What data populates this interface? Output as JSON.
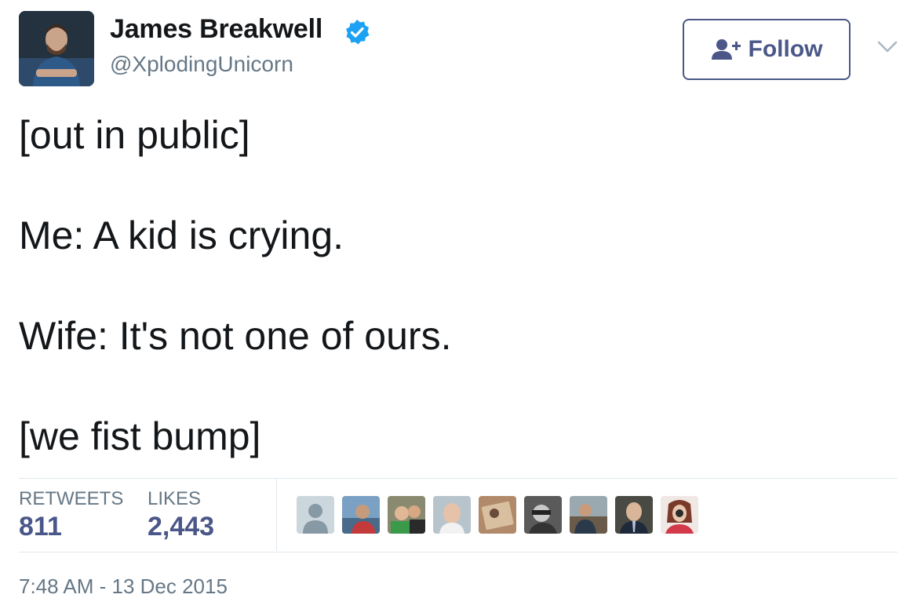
{
  "author": {
    "name": "James Breakwell",
    "handle": "@XplodingUnicorn",
    "verified": true,
    "avatar": "profile-photo"
  },
  "follow_button": {
    "label": "Follow",
    "icon": "add-user-icon",
    "color": "#4a5788"
  },
  "menu_icon": "chevron-down-icon",
  "tweet": {
    "lines": [
      "[out in public]",
      "Me: A kid is crying.",
      "Wife: It's not one of ours.",
      "[we fist bump]"
    ]
  },
  "stats": {
    "retweets_label": "RETWEETS",
    "retweets_value": "811",
    "likes_label": "LIKES",
    "likes_value": "2,443"
  },
  "likers": [
    {
      "avatar": "default-avatar"
    },
    {
      "avatar": "user-photo"
    },
    {
      "avatar": "user-photo"
    },
    {
      "avatar": "user-photo"
    },
    {
      "avatar": "user-photo"
    },
    {
      "avatar": "user-photo"
    },
    {
      "avatar": "user-photo"
    },
    {
      "avatar": "user-photo"
    },
    {
      "avatar": "user-photo"
    }
  ],
  "timestamp": "7:48 AM - 13 Dec 2015",
  "colors": {
    "accent": "#4a5788",
    "verified_badge": "#1da1f2",
    "muted_text": "#657786",
    "divider": "#e1e8ed"
  }
}
